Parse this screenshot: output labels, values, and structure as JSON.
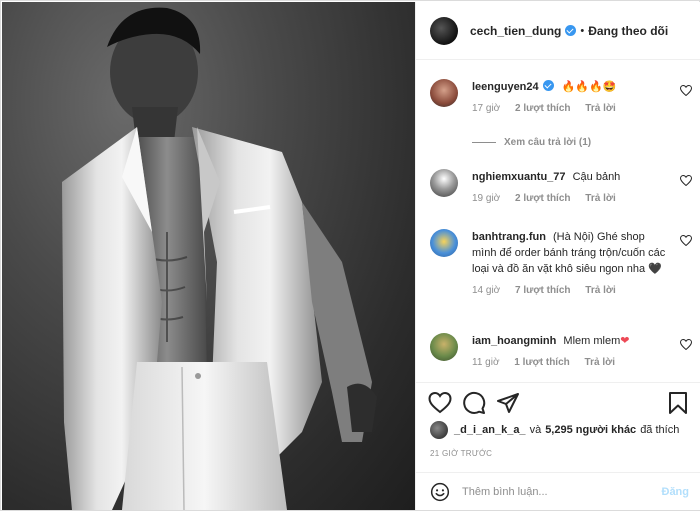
{
  "header": {
    "username": "cech_tien_dung",
    "dot": "•",
    "follow_label": "Đang theo dõi"
  },
  "comments": [
    {
      "user": "leenguyen24",
      "verified": true,
      "text": "🔥🔥🔥🤩",
      "time": "17 giờ",
      "likes": "2 lượt thích",
      "reply": "Trả lời",
      "view_replies": "Xem câu trả lời (1)"
    },
    {
      "user": "nghiemxuantu_77",
      "text": "Cậu bảnh",
      "time": "19 giờ",
      "likes": "2 lượt thích",
      "reply": "Trả lời"
    },
    {
      "user": "banhtrang.fun",
      "text": "(Hà Nội) Ghé shop mình để order bánh tráng trộn/cuốn các loại và đồ ăn vặt khô siêu ngon nha",
      "heart": "🖤",
      "time": "14 giờ",
      "likes": "7 lượt thích",
      "reply": "Trả lời"
    },
    {
      "user": "iam_hoangminh",
      "text": "Mlem mlem",
      "heart": "❤",
      "time": "11 giờ",
      "likes": "1 lượt thích",
      "reply": "Trả lời"
    }
  ],
  "likes": {
    "user": "_d_i_an_k_a_",
    "and": "và",
    "others": "5,295 người khác",
    "suffix": "đã thích"
  },
  "timestamp": "21 GIỜ TRƯỚC",
  "add_comment": {
    "placeholder": "Thêm bình luận...",
    "post_label": "Đăng"
  },
  "icons": [
    "heart-icon",
    "comment-icon",
    "share-icon",
    "bookmark-icon",
    "smiley-icon",
    "verified-icon"
  ],
  "colors": {
    "accent": "#3897f0",
    "muted": "#8e8e8e",
    "post_disabled": "#b2dffc",
    "red_heart": "#ed4956"
  }
}
